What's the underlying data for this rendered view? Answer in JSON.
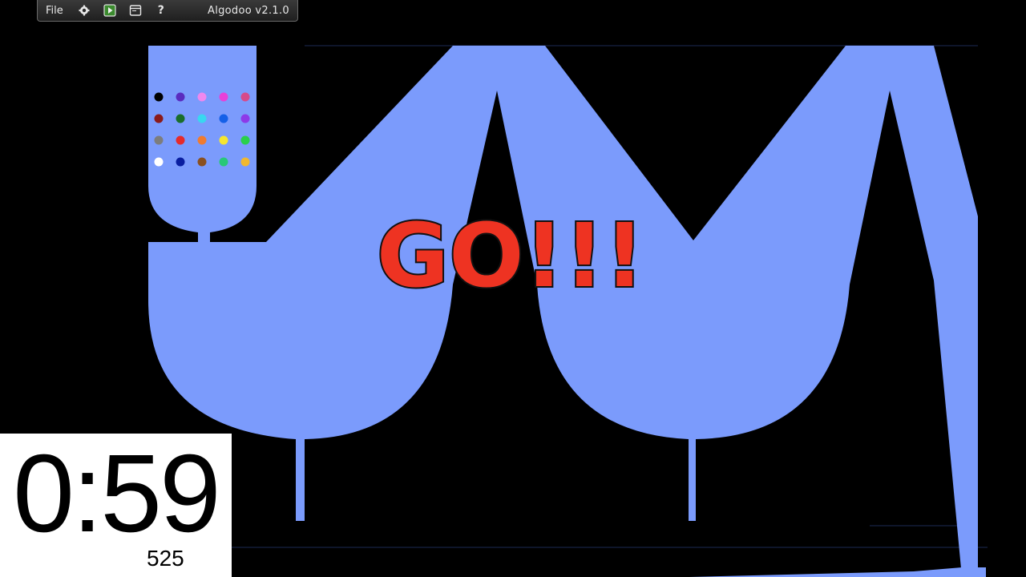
{
  "toolbar": {
    "file_label": "File",
    "settings_icon": "gear-icon",
    "play_icon": "play-icon",
    "window_icon": "window-icon",
    "help_label": "?",
    "version_label": "Algodoo v2.1.0"
  },
  "scene": {
    "overlay_text": "GO!!!",
    "overlay_color": "#ee3322",
    "shape_color": "#7b9bfc",
    "background_color": "#000000",
    "marble_colors": [
      [
        "#000000",
        "#5a2bbf",
        "#ee88ee",
        "#e840d8",
        "#d64a8a"
      ],
      [
        "#8b1a1a",
        "#1a6e2a",
        "#38d8f0",
        "#1460e8",
        "#8d3ae8"
      ],
      [
        "#7d7d7d",
        "#e62a2a",
        "#f07b30",
        "#f5e630",
        "#2ad04a"
      ],
      [
        "#ffffff",
        "#0a1ea0",
        "#8a5020",
        "#28c878",
        "#f0b830"
      ]
    ]
  },
  "hud": {
    "timer": "0:59",
    "counter": "525"
  }
}
